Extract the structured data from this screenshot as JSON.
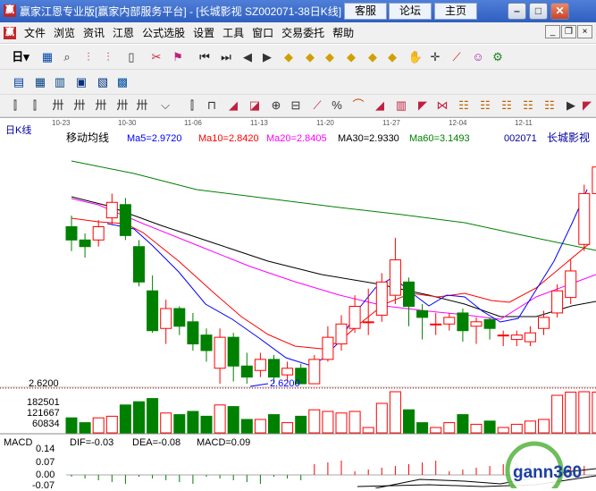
{
  "window": {
    "title": "赢家江恩专业版[赢家内部服务平台] - [长城影视   SZ002071-38日K线]",
    "service_button": "客服",
    "forum_button": "论坛",
    "home_button": "主页"
  },
  "menu": {
    "logo": "赢",
    "items": [
      "文件",
      "浏览",
      "资讯",
      "江恩",
      "公式选股",
      "设置",
      "工具",
      "窗口",
      "交易委托",
      "帮助"
    ]
  },
  "toolbar1": {
    "period_label": "日"
  },
  "chart_header": {
    "dates": [
      "10-23",
      "10-30",
      "11-06",
      "11-13",
      "11-20",
      "11-27",
      "12-04",
      "12-11"
    ]
  },
  "kline": {
    "panel_label": "日K线",
    "indicator_name": "移动均线",
    "ma5": "Ma5=2.9720",
    "ma10": "Ma10=2.8420",
    "ma20": "Ma20=2.8405",
    "ma30": "MA30=2.9330",
    "ma60": "Ma60=3.1493",
    "code": "002071",
    "name": "长城影视",
    "low_label": "2.6200",
    "price_label": "2.6200",
    "colors": {
      "ma5": "#0000ff",
      "ma10": "#ff0000",
      "ma20": "#ff00ff",
      "ma30": "#000000",
      "ma60": "#008000",
      "up": "#ff0000",
      "down": "#008000"
    }
  },
  "volume": {
    "ticks": [
      "182501",
      "121667",
      "60834"
    ]
  },
  "macd": {
    "label": "MACD",
    "dif": "DIF=-0.03",
    "dea": "DEA=-0.08",
    "macd": "MACD=0.09",
    "ticks": [
      "0.14",
      "0.07",
      "0.00",
      "-0.07"
    ]
  },
  "watermark": {
    "text": "gann360"
  },
  "chart_data": {
    "type": "candlestick",
    "series": [
      {
        "name": "K",
        "values": [
          {
            "o": 3.33,
            "c": 3.27,
            "h": 3.38,
            "l": 3.22
          },
          {
            "o": 3.27,
            "c": 3.24,
            "h": 3.3,
            "l": 3.19
          },
          {
            "o": 3.27,
            "c": 3.33,
            "h": 3.36,
            "l": 3.24
          },
          {
            "o": 3.37,
            "c": 3.44,
            "h": 3.48,
            "l": 3.34
          },
          {
            "o": 3.43,
            "c": 3.29,
            "h": 3.46,
            "l": 3.27
          },
          {
            "o": 3.24,
            "c": 3.08,
            "h": 3.27,
            "l": 3.06
          },
          {
            "o": 3.04,
            "c": 2.86,
            "h": 3.11,
            "l": 2.85
          },
          {
            "o": 2.87,
            "c": 2.96,
            "h": 3.0,
            "l": 2.8
          },
          {
            "o": 2.96,
            "c": 2.88,
            "h": 2.97,
            "l": 2.84
          },
          {
            "o": 2.9,
            "c": 2.8,
            "h": 2.94,
            "l": 2.77
          },
          {
            "o": 2.84,
            "c": 2.77,
            "h": 2.87,
            "l": 2.72
          },
          {
            "o": 2.69,
            "c": 2.83,
            "h": 2.87,
            "l": 2.62
          },
          {
            "o": 2.83,
            "c": 2.7,
            "h": 2.85,
            "l": 2.63
          },
          {
            "o": 2.7,
            "c": 2.65,
            "h": 2.76,
            "l": 2.62
          },
          {
            "o": 2.68,
            "c": 2.73,
            "h": 2.76,
            "l": 2.65
          },
          {
            "o": 2.73,
            "c": 2.65,
            "h": 2.75,
            "l": 2.62
          },
          {
            "o": 2.66,
            "c": 2.69,
            "h": 2.72,
            "l": 2.63
          },
          {
            "o": 2.69,
            "c": 2.62,
            "h": 2.71,
            "l": 2.62
          },
          {
            "o": 2.62,
            "c": 2.73,
            "h": 2.75,
            "l": 2.62
          },
          {
            "o": 2.73,
            "c": 2.83,
            "h": 2.88,
            "l": 2.72
          },
          {
            "o": 2.8,
            "c": 2.89,
            "h": 2.93,
            "l": 2.77
          },
          {
            "o": 2.87,
            "c": 2.97,
            "h": 3.02,
            "l": 2.85
          },
          {
            "o": 2.9,
            "c": 2.9,
            "h": 3.05,
            "l": 2.84
          },
          {
            "o": 2.93,
            "c": 3.08,
            "h": 3.12,
            "l": 2.9
          },
          {
            "o": 3.02,
            "c": 3.18,
            "h": 3.28,
            "l": 2.98
          },
          {
            "o": 3.08,
            "c": 2.97,
            "h": 3.1,
            "l": 2.88
          },
          {
            "o": 2.95,
            "c": 2.92,
            "h": 2.98,
            "l": 2.82
          },
          {
            "o": 2.89,
            "c": 2.89,
            "h": 2.94,
            "l": 2.84
          },
          {
            "o": 2.89,
            "c": 2.92,
            "h": 2.94,
            "l": 2.86
          },
          {
            "o": 2.94,
            "c": 2.86,
            "h": 2.96,
            "l": 2.81
          },
          {
            "o": 2.88,
            "c": 2.9,
            "h": 2.92,
            "l": 2.8
          },
          {
            "o": 2.91,
            "c": 2.87,
            "h": 2.92,
            "l": 2.82
          },
          {
            "o": 2.84,
            "c": 2.84,
            "h": 2.86,
            "l": 2.79
          },
          {
            "o": 2.82,
            "c": 2.84,
            "h": 2.86,
            "l": 2.79
          },
          {
            "o": 2.81,
            "c": 2.85,
            "h": 2.88,
            "l": 2.79
          },
          {
            "o": 2.87,
            "c": 2.92,
            "h": 2.95,
            "l": 2.84
          },
          {
            "o": 2.94,
            "c": 3.04,
            "h": 3.07,
            "l": 2.92
          },
          {
            "o": 3.01,
            "c": 3.13,
            "h": 3.18,
            "l": 2.98
          },
          {
            "o": 3.25,
            "c": 3.48,
            "h": 3.52,
            "l": 3.22
          },
          {
            "o": 3.48,
            "c": 3.6,
            "h": 3.63,
            "l": 3.46
          }
        ]
      }
    ]
  }
}
